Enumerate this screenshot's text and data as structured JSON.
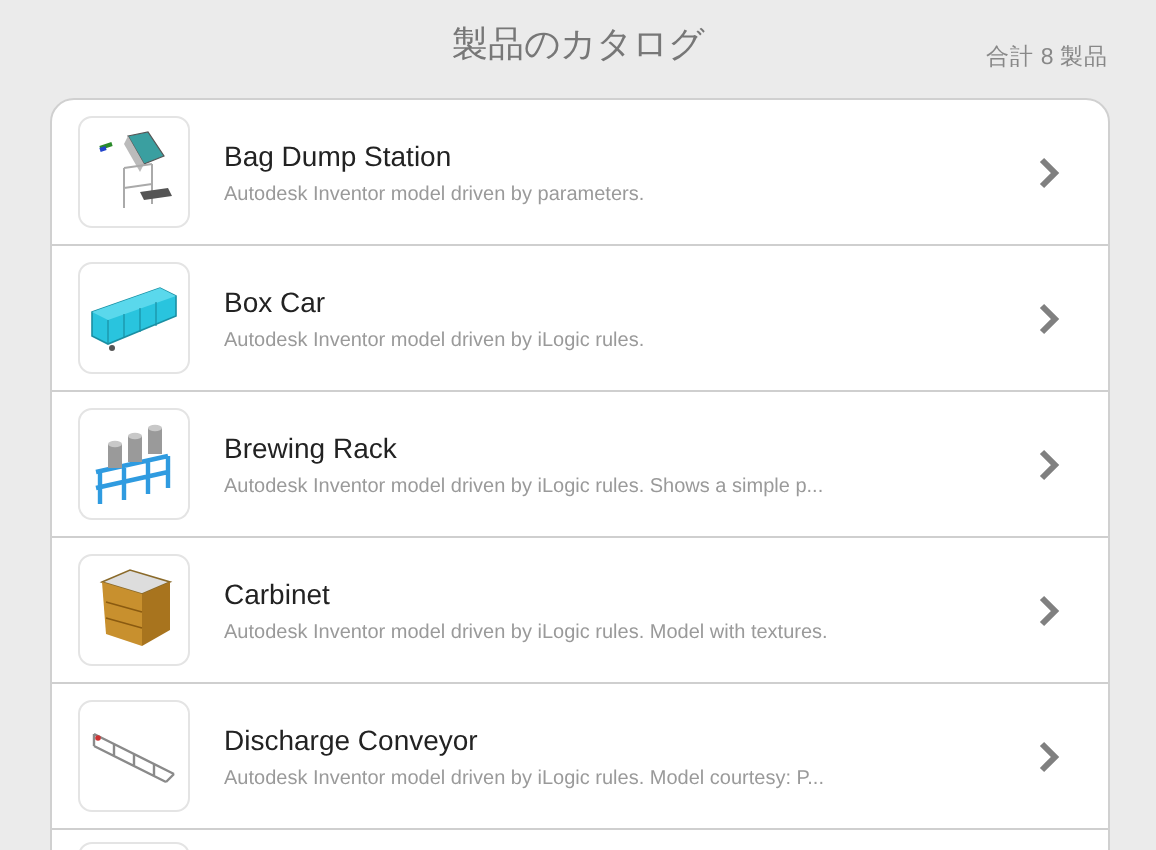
{
  "header": {
    "title": "製品のカタログ",
    "count": "合計 8 製品"
  },
  "products": [
    {
      "kind": "station",
      "name": "Bag Dump Station",
      "description": "Autodesk Inventor model driven by parameters."
    },
    {
      "kind": "railcar",
      "name": "Box Car",
      "description": "Autodesk Inventor model driven by iLogic rules."
    },
    {
      "kind": "rack",
      "name": "Brewing Rack",
      "description": "Autodesk Inventor model driven by iLogic rules. Shows a simple p..."
    },
    {
      "kind": "cabinet",
      "name": "Carbinet",
      "description": "Autodesk Inventor model driven by iLogic rules. Model with textures."
    },
    {
      "kind": "conveyor",
      "name": "Discharge Conveyor",
      "description": "Autodesk Inventor model driven by iLogic rules. Model courtesy: P..."
    }
  ]
}
